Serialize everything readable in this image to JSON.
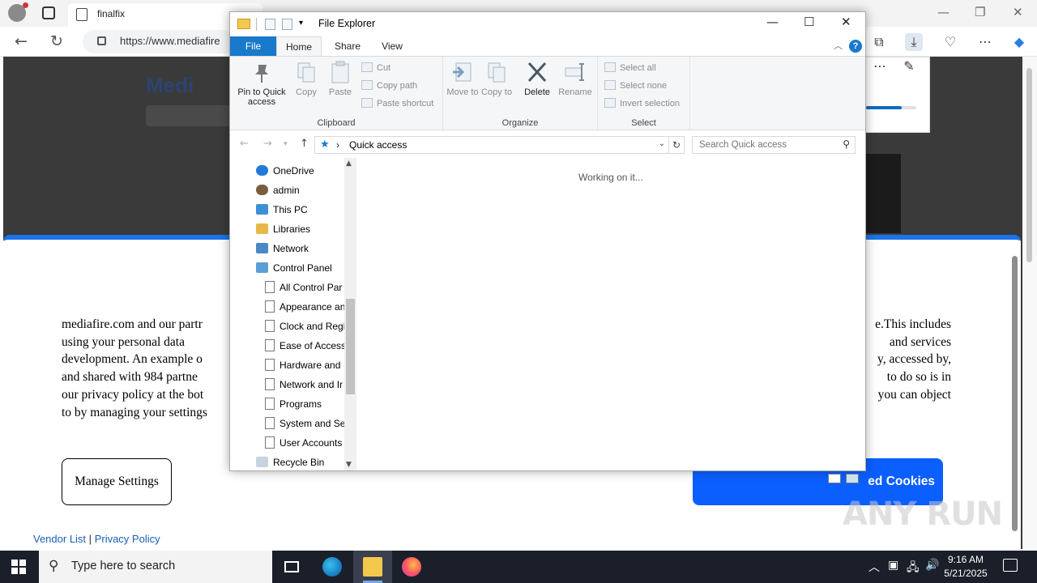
{
  "browser": {
    "tab_title": "finalfix",
    "url": "https://www.mediafire",
    "icons": [
      "profile-icon",
      "tab-actions-icon",
      "back-icon",
      "refresh-icon",
      "lock-icon",
      "collections-icon",
      "download-icon",
      "performance-icon",
      "menu-icon",
      "copilot-icon"
    ]
  },
  "page": {
    "logo_text": "Medi",
    "consent_text": "mediafire.com and our partners ... This includes using your personal data ... and services development. An example o ... accessed by, and shared with 984 partne ... to do so is in our privacy policy at the bot ... you can object to by managing your settings",
    "consent_lines": [
      {
        "left": "mediafire.com and our partr",
        "right": "e.This includes"
      },
      {
        "left": "using your personal data",
        "right": "and services"
      },
      {
        "left": "development. An example o",
        "right": "y, accessed by,"
      },
      {
        "left": "and shared with 984 partne",
        "right": "to do so is in"
      },
      {
        "left": "our privacy policy at the bot",
        "right": "you can object"
      },
      {
        "left": "to by managing your settings",
        "right": ""
      }
    ],
    "manage_label": "Manage Settings",
    "accept_label": "ed Cookies",
    "vendor_link": "Vendor List",
    "separator": "|",
    "privacy_link": "Privacy Policy",
    "watermark": "ANY RUN",
    "accent_color": "#1a73e8"
  },
  "explorer": {
    "title": "File Explorer",
    "tabs": {
      "file": "File",
      "home": "Home",
      "share": "Share",
      "view": "View"
    },
    "help": "?",
    "clipboard": {
      "label": "Clipboard",
      "pin": "Pin to Quick access",
      "copy": "Copy",
      "paste": "Paste",
      "cut": "Cut",
      "copy_path": "Copy path",
      "paste_shortcut": "Paste shortcut"
    },
    "organize": {
      "label": "Organize",
      "move_to": "Move to",
      "copy_to": "Copy to",
      "delete": "Delete",
      "rename": "Rename"
    },
    "select": {
      "label": "Select",
      "select_all": "Select all",
      "select_none": "Select none",
      "invert": "Invert selection"
    },
    "address": {
      "path": "Quick access",
      "search_placeholder": "Search Quick access"
    },
    "nav_items": [
      {
        "label": "OneDrive",
        "icon": "onedrive-icon"
      },
      {
        "label": "admin",
        "icon": "user-icon"
      },
      {
        "label": "This PC",
        "icon": "pc-icon"
      },
      {
        "label": "Libraries",
        "icon": "libraries-icon"
      },
      {
        "label": "Network",
        "icon": "network-icon"
      },
      {
        "label": "Control Panel",
        "icon": "control-panel-icon"
      },
      {
        "label": "All Control Par",
        "icon": "page-icon"
      },
      {
        "label": "Appearance an",
        "icon": "page-icon"
      },
      {
        "label": "Clock and Regi",
        "icon": "page-icon"
      },
      {
        "label": "Ease of Access",
        "icon": "page-icon"
      },
      {
        "label": "Hardware and",
        "icon": "page-icon"
      },
      {
        "label": "Network and Ir",
        "icon": "page-icon"
      },
      {
        "label": "Programs",
        "icon": "page-icon"
      },
      {
        "label": "System and Se",
        "icon": "page-icon"
      },
      {
        "label": "User Accounts",
        "icon": "page-icon"
      },
      {
        "label": "Recycle Bin",
        "icon": "recycle-bin-icon"
      }
    ],
    "status": "Working on it..."
  },
  "taskbar": {
    "search_placeholder": "Type here to search",
    "time": "9:16 AM",
    "date": "5/21/2025"
  }
}
